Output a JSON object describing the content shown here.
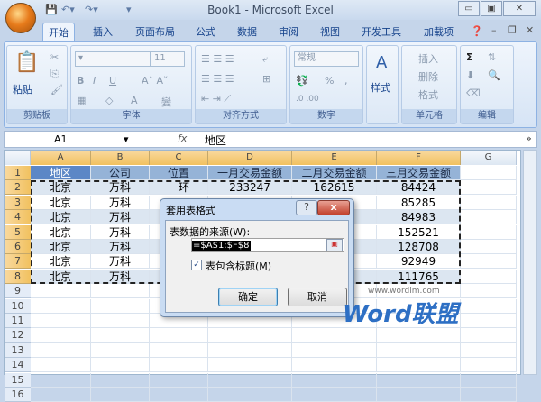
{
  "window": {
    "title": "Book1 - Microsoft Excel"
  },
  "tabs": [
    "开始",
    "插入",
    "页面布局",
    "公式",
    "数据",
    "审阅",
    "视图",
    "开发工具",
    "加载项"
  ],
  "ribbon": {
    "groups": [
      "剪贴板",
      "字体",
      "对齐方式",
      "数字",
      "",
      "单元格",
      "编辑"
    ],
    "paste": "粘贴",
    "font_size": "11",
    "number_format": "常规",
    "styles": "样式",
    "insert": "插入",
    "delete": "删除",
    "format": "格式",
    "percent": "%",
    "comma": ","
  },
  "formula_bar": {
    "name_box": "A1",
    "fx": "fx",
    "value": "地区"
  },
  "sheet": {
    "columns": [
      "A",
      "B",
      "C",
      "D",
      "E",
      "F",
      "G"
    ],
    "rows": [
      "1",
      "2",
      "3",
      "4",
      "5",
      "6",
      "7",
      "8",
      "9",
      "10",
      "11",
      "12",
      "13",
      "14",
      "15",
      "16"
    ],
    "header": [
      "地区",
      "公司",
      "位置",
      "一月交易金额",
      "二月交易金额",
      "三月交易金额"
    ],
    "data": [
      [
        "北京",
        "万科",
        "一环",
        "233247",
        "162615",
        "84424"
      ],
      [
        "北京",
        "万科",
        "",
        "",
        "",
        "85285"
      ],
      [
        "北京",
        "万科",
        "",
        "",
        "",
        "84983"
      ],
      [
        "北京",
        "万科",
        "",
        "",
        "",
        "152521"
      ],
      [
        "北京",
        "万科",
        "",
        "",
        "",
        "128708"
      ],
      [
        "北京",
        "万科",
        "",
        "",
        "",
        "92949"
      ],
      [
        "北京",
        "万科",
        "",
        "",
        "",
        "111765"
      ]
    ]
  },
  "dialog": {
    "title": "套用表格式",
    "help": "?",
    "close": "x",
    "source_label": "表数据的来源(W):",
    "source_value": "=$A$1:$F$8",
    "has_headers_label": "表包含标题(M)",
    "has_headers_checked": true,
    "ok": "确定",
    "cancel": "取消"
  },
  "watermark": {
    "url": "www.wordlm.com",
    "brand": "Word联盟"
  }
}
